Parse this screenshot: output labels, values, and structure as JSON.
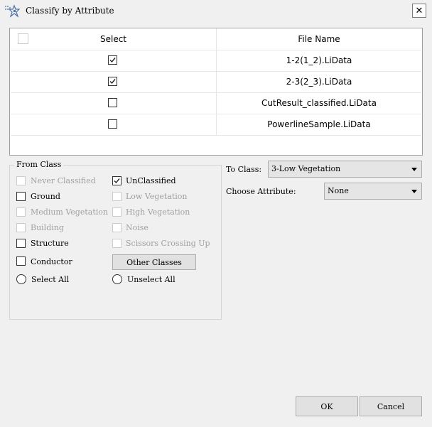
{
  "window": {
    "title": "Classify by Attribute",
    "close_glyph": "✕"
  },
  "table": {
    "headers": {
      "select": "Select",
      "file_name": "File Name"
    },
    "rows": [
      {
        "checked": true,
        "file": "1-2(1_2).LiData"
      },
      {
        "checked": true,
        "file": "2-3(2_3).LiData"
      },
      {
        "checked": false,
        "file": "CutResult_classified.LiData"
      },
      {
        "checked": false,
        "file": "PowerlineSample.LiData"
      }
    ]
  },
  "from_class": {
    "legend": "From Class",
    "options": [
      {
        "label": "Never Classified",
        "checked": false,
        "enabled": false
      },
      {
        "label": "UnClassified",
        "checked": true,
        "enabled": true
      },
      {
        "label": "Ground",
        "checked": false,
        "enabled": true
      },
      {
        "label": "Low Vegetation",
        "checked": false,
        "enabled": false
      },
      {
        "label": "Medium Vegetation",
        "checked": false,
        "enabled": false
      },
      {
        "label": "High Vegetation",
        "checked": false,
        "enabled": false
      },
      {
        "label": "Building",
        "checked": false,
        "enabled": false
      },
      {
        "label": "Noise",
        "checked": false,
        "enabled": false
      },
      {
        "label": "Structure",
        "checked": false,
        "enabled": true
      },
      {
        "label": "Scissors Crossing Up",
        "checked": false,
        "enabled": false
      },
      {
        "label": "Conductor",
        "checked": false,
        "enabled": true
      }
    ],
    "other_classes_label": "Other Classes",
    "select_all_label": "Select All",
    "unselect_all_label": "Unselect All"
  },
  "to_class": {
    "label": "To Class:",
    "value": "3-Low Vegetation"
  },
  "choose_attribute": {
    "label": "Choose Attribute:",
    "value": "None"
  },
  "buttons": {
    "ok": "OK",
    "cancel": "Cancel"
  },
  "colors": {
    "background": "#f0f0f0",
    "disabled_text": "#a0a0a0"
  }
}
